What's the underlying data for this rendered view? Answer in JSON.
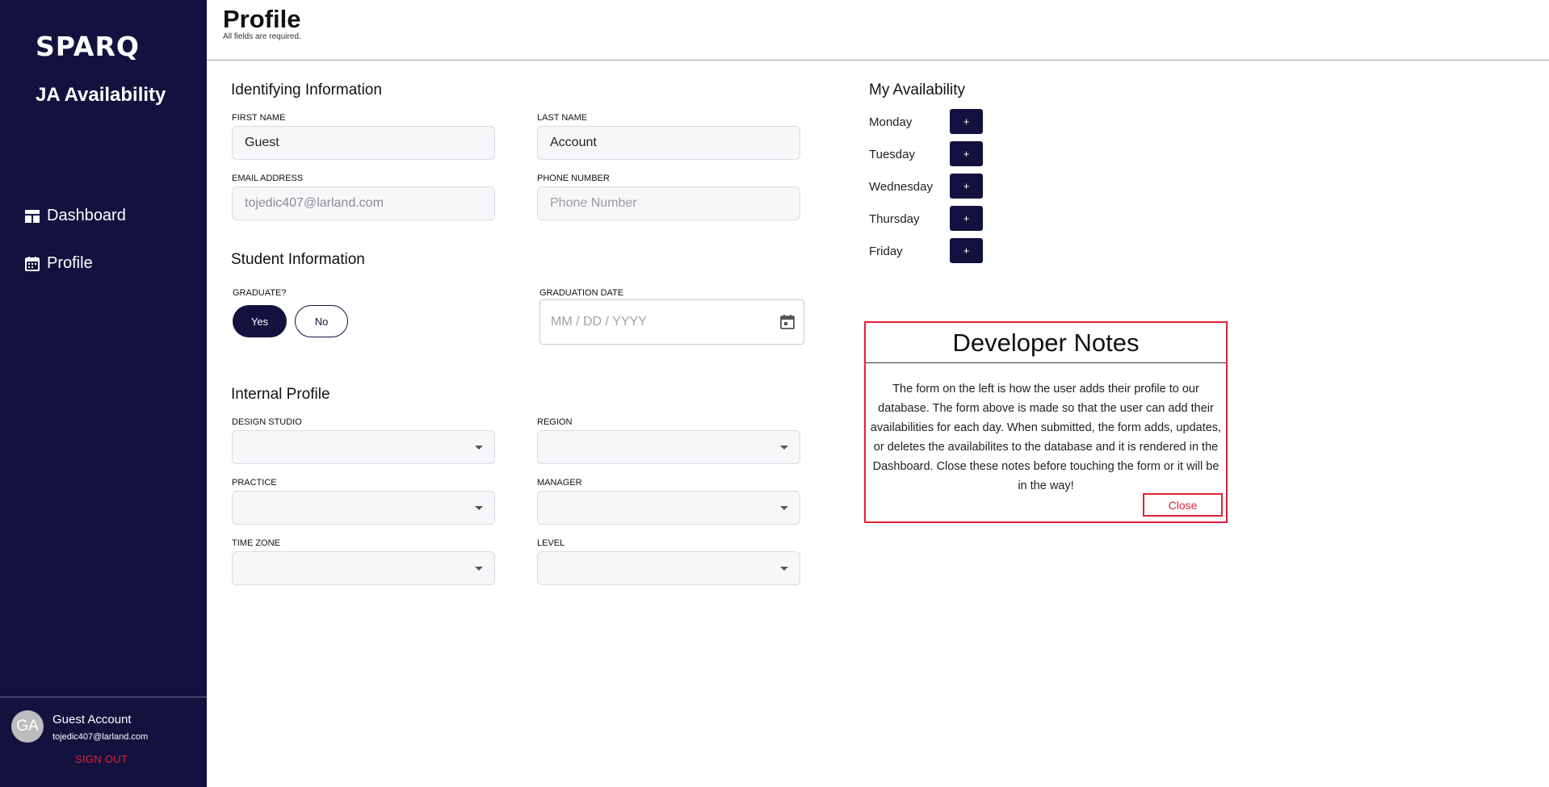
{
  "sidebar": {
    "logo": "SPARQ",
    "app_name": "JA Availability",
    "nav": [
      {
        "label": "Dashboard",
        "icon": "dashboard-icon"
      },
      {
        "label": "Profile",
        "icon": "calendar-icon"
      }
    ],
    "user": {
      "initials": "GA",
      "name": "Guest Account",
      "email": "tojedic407@larland.com",
      "sign_out": "SIGN OUT"
    }
  },
  "header": {
    "title": "Profile",
    "subtitle": "All fields are required."
  },
  "form": {
    "identifying": {
      "title": "Identifying Information",
      "first_name": {
        "label": "FIRST NAME",
        "value": "Guest"
      },
      "last_name": {
        "label": "LAST NAME",
        "value": "Account"
      },
      "email": {
        "label": "EMAIL ADDRESS",
        "value": "tojedic407@larland.com"
      },
      "phone": {
        "label": "PHONE NUMBER",
        "placeholder": "Phone Number"
      }
    },
    "student": {
      "title": "Student Information",
      "graduate_label": "GRADUATE?",
      "yes": "Yes",
      "no": "No",
      "graduate_selected": "Yes",
      "grad_date_label": "GRADUATION DATE",
      "grad_date_placeholder": "MM / DD / YYYY"
    },
    "internal": {
      "title": "Internal Profile",
      "design_studio": "DESIGN STUDIO",
      "region": "REGION",
      "practice": "PRACTICE",
      "manager": "MANAGER",
      "time_zone": "TIME ZONE",
      "level": "LEVEL"
    }
  },
  "availability": {
    "title": "My Availability",
    "days": [
      "Monday",
      "Tuesday",
      "Wednesday",
      "Thursday",
      "Friday"
    ],
    "add_label": "+"
  },
  "dev_notes": {
    "title": "Developer Notes",
    "body": "The form on the left is how the user adds their profile to our database. The form above is made so that the user can add their availabilities for each day. When submitted, the form adds, updates, or deletes the availabilites to the database and it is rendered in the Dashboard. Close these notes before touching the form or it will be in the way!",
    "close": "Close"
  },
  "colors": {
    "sidebar_bg": "#13123f",
    "primary": "#13123f",
    "danger": "#e0203a"
  }
}
